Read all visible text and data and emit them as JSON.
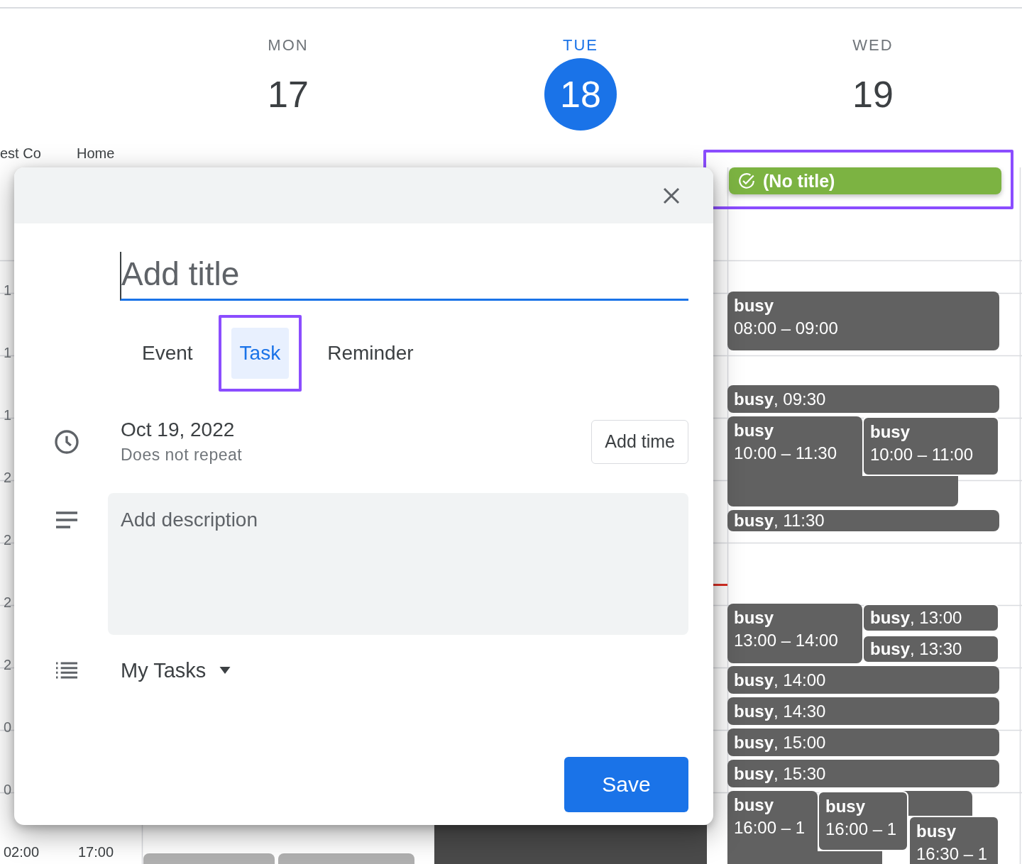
{
  "days": [
    {
      "weekday": "MON",
      "date": "17",
      "today": false
    },
    {
      "weekday": "TUE",
      "date": "18",
      "today": true
    },
    {
      "weekday": "WED",
      "date": "19",
      "today": false
    }
  ],
  "calendar_labels": [
    "est Co",
    "Home"
  ],
  "hour_labels": [
    "1",
    "1",
    "1",
    "2",
    "2",
    "2",
    "2",
    "0",
    "0"
  ],
  "bottom_labels": [
    "02:00",
    "17:00"
  ],
  "events": [
    {
      "kind": "task",
      "title": "(No title)",
      "color": "#7cb342",
      "highlighted": true
    },
    {
      "kind": "block",
      "title": "busy",
      "time": "08:00 – 09:00"
    },
    {
      "kind": "chip",
      "text": "**busy**, 09:30"
    },
    {
      "kind": "block",
      "title": "busy",
      "time": "10:00 – 11:30"
    },
    {
      "kind": "block",
      "title": "busy",
      "time": "10:00 – 11:00"
    },
    {
      "kind": "chip",
      "text": "**busy**, 11:30"
    },
    {
      "kind": "block",
      "title": "busy",
      "time": "13:00 – 14:00"
    },
    {
      "kind": "chip",
      "text": "**busy**, 13:00"
    },
    {
      "kind": "chip",
      "text": "**busy**, 13:30"
    },
    {
      "kind": "chip",
      "text": "**busy**, 14:00"
    },
    {
      "kind": "chip",
      "text": "**busy**, 14:30"
    },
    {
      "kind": "chip",
      "text": "**busy**, 15:00"
    },
    {
      "kind": "chip",
      "text": "**busy**, 15:30"
    },
    {
      "kind": "block",
      "title": "busy",
      "time": "16:00 – 1"
    },
    {
      "kind": "block",
      "title": "busy",
      "time": "16:00 – 1"
    },
    {
      "kind": "block",
      "title": "busy",
      "time": "16:30 – 1"
    }
  ],
  "dialog": {
    "title_placeholder": "Add title",
    "types": [
      {
        "label": "Event",
        "selected": false,
        "highlighted": false
      },
      {
        "label": "Task",
        "selected": true,
        "highlighted": true
      },
      {
        "label": "Reminder",
        "selected": false,
        "highlighted": false
      }
    ],
    "date": "Oct 19, 2022",
    "repeat": "Does not repeat",
    "add_time": "Add time",
    "description_placeholder": "Add description",
    "task_list": "My Tasks",
    "save": "Save"
  }
}
